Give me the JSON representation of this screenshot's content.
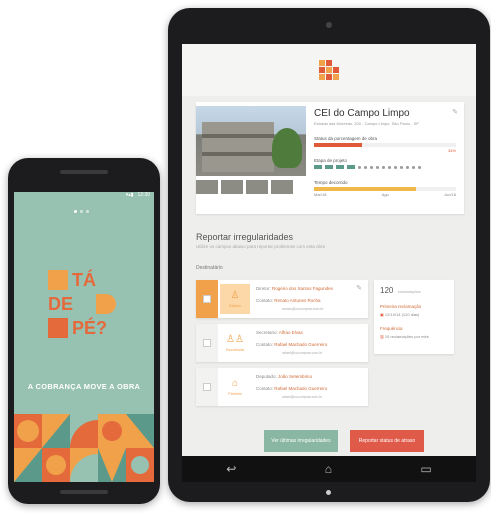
{
  "tablet": {
    "school": {
      "name": "CEI do Campo Limpo",
      "address": "Estrada das Moreiras, 200 - Campo Limpo, São Paulo - SP",
      "metrics": [
        {
          "label": "Status da porcentagem de obra",
          "value_pct": 0.34,
          "pct_label": "34%",
          "color": "#e05a3a"
        },
        {
          "label": "Etapa de projeto",
          "value_pct": 0.3,
          "color": "#5b9a8b"
        },
        {
          "label": "Tempo decorrido",
          "value_pct": 0.72,
          "color": "#f0b84a"
        }
      ],
      "tick_labels": [
        "Mar/18",
        "Ago",
        "Jun/18"
      ]
    },
    "report": {
      "title": "Reportar irregularidades",
      "subtitle": "Utilize os campos abaixo para reportar problemas com esta obra",
      "section_label": "Destinatário",
      "recipients": [
        {
          "role": "Diretor",
          "icon": "person-icon",
          "line1_label": "Diretor:",
          "line1_value": "Rogério dos Santos Fagundes",
          "line2_label": "Contato:",
          "line2_value": "Renato Antunes Rocha",
          "email": "renato@cocomprar.com.br",
          "active": true
        },
        {
          "role": "Secretaria",
          "icon": "group-icon",
          "line1_label": "Secretario:",
          "line1_value": "Alfrao Elvas",
          "line2_label": "Contato:",
          "line2_value": "Rafael Machado Guerreiro",
          "email": "rafael@cocomprar.com.br",
          "active": false
        },
        {
          "role": "Prefeito",
          "icon": "building-icon",
          "line1_label": "Deputado:",
          "line1_value": "João Setembrino",
          "line2_label": "Contato:",
          "line2_value": "Rafael Machado Guerreiro",
          "email": "rafael@cocomprar.com.br",
          "active": false
        }
      ],
      "stats": {
        "count": "120",
        "count_label": "reclamações",
        "first_label": "Primeira reclamação",
        "first_value": "12/10/14 (120 dias)",
        "freq_label": "Frequência",
        "freq_value": "15 reclamações por mês"
      },
      "btn_green": "Ver últimas irregularidades",
      "btn_red": "Reportar status de atraso"
    }
  },
  "phone": {
    "status_time": "12:30",
    "logo": {
      "ta": "TÁ",
      "de": "DE",
      "pe": "PÉ?"
    },
    "slogan": "A COBRANÇA MOVE A OBRA"
  },
  "colors": {
    "orange": "#f0a14a",
    "red_orange": "#e05a3a",
    "teal": "#97c1b0",
    "brand_text": "#e46a3c"
  }
}
